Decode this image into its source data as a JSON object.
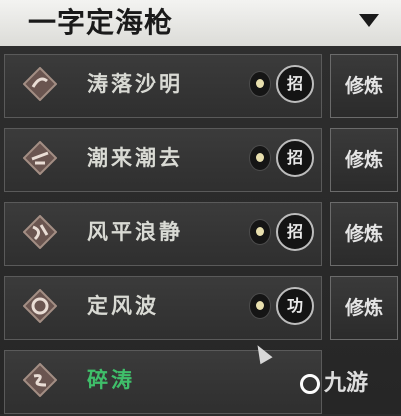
{
  "header": {
    "title": "一字定海枪",
    "dropdown_icon": "triangle-down-icon"
  },
  "skills": [
    {
      "name": "涛落沙明",
      "type_label": "招",
      "action_label": "修炼",
      "active": false
    },
    {
      "name": "潮来潮去",
      "type_label": "招",
      "action_label": "修炼",
      "active": false
    },
    {
      "name": "风平浪静",
      "type_label": "招",
      "action_label": "修炼",
      "active": false
    },
    {
      "name": "定风波",
      "type_label": "功",
      "action_label": "修炼",
      "active": false
    },
    {
      "name": "碎涛",
      "active": true
    }
  ],
  "watermark": {
    "text": "九游"
  },
  "colors": {
    "active_skill": "#3fbf6a",
    "header_bg": "#ecece9"
  }
}
